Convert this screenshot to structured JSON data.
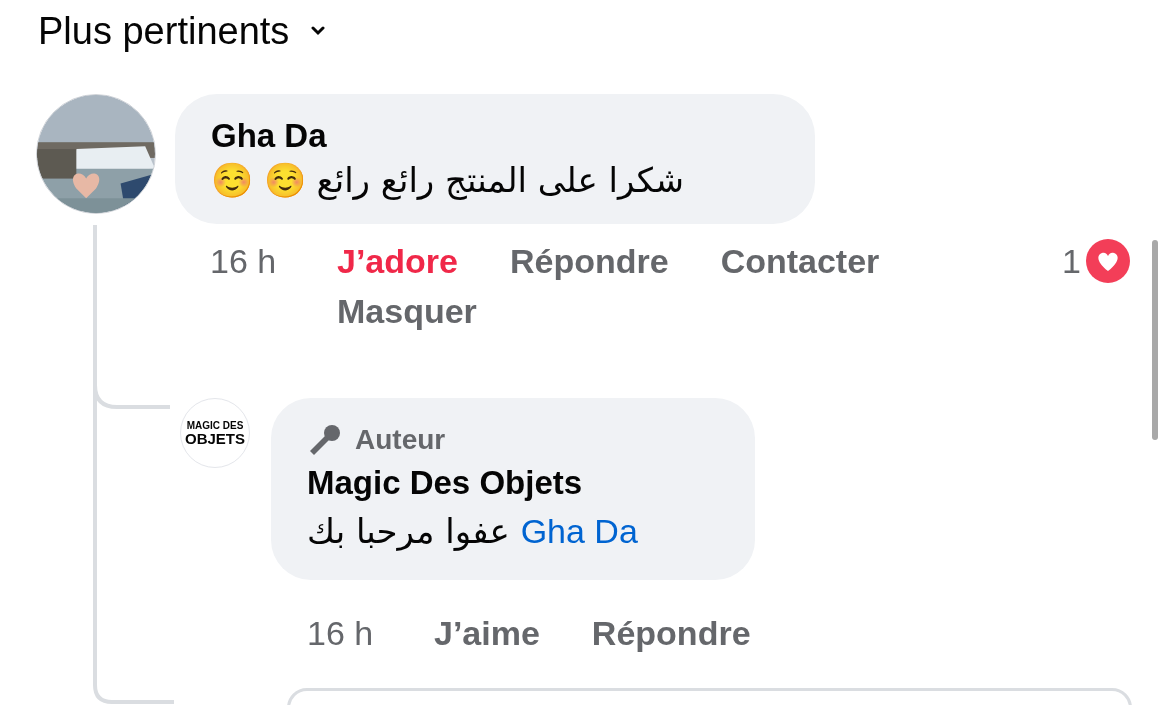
{
  "sort_menu": {
    "label": "Plus pertinents"
  },
  "comment": {
    "author": "Gha Da",
    "text": "شكرا على المنتج رائع رائع ☺️ ☺️",
    "time": "16 h",
    "reaction": {
      "label": "J’adore",
      "selected": true
    },
    "actions": [
      "Répondre",
      "Contacter",
      "Masquer"
    ],
    "reactions": {
      "count": "1"
    }
  },
  "reply": {
    "badge": "Auteur",
    "author": "Magic Des Objets",
    "avatar_logo": [
      "MAGIC DES",
      "OBJETS"
    ],
    "mention": "Gha Da",
    "text": "عفوا مرحبا بك",
    "time": "16 h",
    "reaction": {
      "label": "J’aime",
      "selected": false
    },
    "actions": [
      "Répondre"
    ]
  }
}
